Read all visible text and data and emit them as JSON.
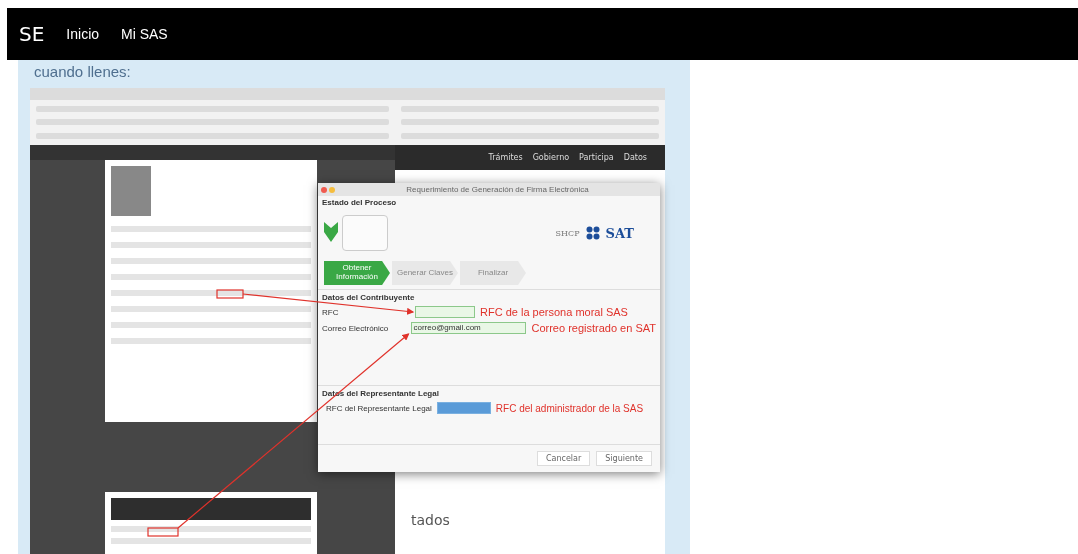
{
  "nav": {
    "brand": "SE",
    "links": [
      {
        "label": "Inicio"
      },
      {
        "label": "Mi SAS"
      }
    ]
  },
  "intro": "cuando llenes:",
  "screenshot": {
    "site_menu": [
      "Trámites",
      "Gobierno",
      "Participa",
      "Datos"
    ],
    "background_heading": "tados",
    "dialog": {
      "title": "Requerimiento de Generación de Firma Electrónica",
      "section": "Estado del Proceso",
      "logos": [
        "SHCP",
        "SAT"
      ],
      "steps": [
        {
          "label": "Obtener Información",
          "selected": true
        },
        {
          "label": "Generar Claves",
          "selected": false
        },
        {
          "label": "Finalizar",
          "selected": false
        }
      ],
      "groups": [
        {
          "title": "Datos del Contribuyente",
          "fields": [
            {
              "label": "RFC",
              "highlighted": false,
              "note": "RFC de la persona moral SAS"
            },
            {
              "label": "Correo Electrónico",
              "value": "correo@gmail.com",
              "highlighted": false,
              "note": "Correo registrado en SAT"
            }
          ]
        },
        {
          "title": "Datos del Representante Legal",
          "fields": [
            {
              "label": "RFC del Representante Legal",
              "highlighted": true,
              "note": "RFC del administrador de la SAS"
            }
          ]
        }
      ],
      "buttons": [
        "Cancelar",
        "Siguiente"
      ]
    }
  }
}
